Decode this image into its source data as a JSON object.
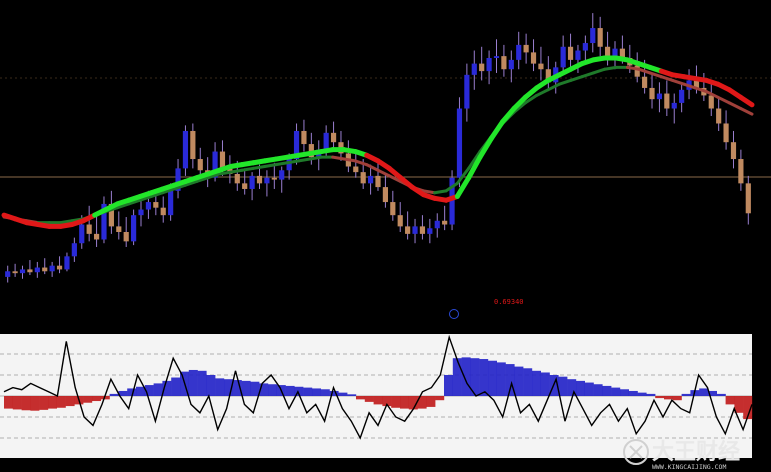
{
  "chart_data": [
    {
      "type": "candlestick",
      "panel": "price",
      "readout": "0.69340",
      "colors": {
        "up": "#2a2ad8",
        "down": "#c08a60",
        "wick": "#9a7fd0",
        "hline": "#8a6a4a"
      },
      "candles": [
        {
          "o": 4,
          "h": 16,
          "l": -2,
          "c": 10
        },
        {
          "o": 10,
          "h": 18,
          "l": 4,
          "c": 8
        },
        {
          "o": 8,
          "h": 16,
          "l": 2,
          "c": 12
        },
        {
          "o": 12,
          "h": 22,
          "l": 6,
          "c": 9
        },
        {
          "o": 9,
          "h": 20,
          "l": 3,
          "c": 14
        },
        {
          "o": 14,
          "h": 24,
          "l": 7,
          "c": 10
        },
        {
          "o": 10,
          "h": 20,
          "l": 4,
          "c": 16
        },
        {
          "o": 16,
          "h": 26,
          "l": 8,
          "c": 12
        },
        {
          "o": 12,
          "h": 30,
          "l": 10,
          "c": 26
        },
        {
          "o": 26,
          "h": 46,
          "l": 20,
          "c": 40
        },
        {
          "o": 40,
          "h": 70,
          "l": 34,
          "c": 60
        },
        {
          "o": 60,
          "h": 80,
          "l": 42,
          "c": 50
        },
        {
          "o": 50,
          "h": 72,
          "l": 36,
          "c": 44
        },
        {
          "o": 44,
          "h": 90,
          "l": 40,
          "c": 82
        },
        {
          "o": 82,
          "h": 96,
          "l": 50,
          "c": 58
        },
        {
          "o": 58,
          "h": 74,
          "l": 44,
          "c": 52
        },
        {
          "o": 52,
          "h": 68,
          "l": 36,
          "c": 42
        },
        {
          "o": 42,
          "h": 76,
          "l": 38,
          "c": 70
        },
        {
          "o": 70,
          "h": 88,
          "l": 58,
          "c": 76
        },
        {
          "o": 76,
          "h": 96,
          "l": 66,
          "c": 84
        },
        {
          "o": 84,
          "h": 98,
          "l": 70,
          "c": 78
        },
        {
          "o": 78,
          "h": 90,
          "l": 62,
          "c": 70
        },
        {
          "o": 70,
          "h": 104,
          "l": 64,
          "c": 96
        },
        {
          "o": 96,
          "h": 130,
          "l": 88,
          "c": 120
        },
        {
          "o": 120,
          "h": 166,
          "l": 112,
          "c": 160
        },
        {
          "o": 160,
          "h": 168,
          "l": 120,
          "c": 130
        },
        {
          "o": 130,
          "h": 142,
          "l": 106,
          "c": 118
        },
        {
          "o": 118,
          "h": 132,
          "l": 100,
          "c": 110
        },
        {
          "o": 110,
          "h": 148,
          "l": 106,
          "c": 138
        },
        {
          "o": 138,
          "h": 150,
          "l": 112,
          "c": 120
        },
        {
          "o": 120,
          "h": 134,
          "l": 104,
          "c": 114
        },
        {
          "o": 114,
          "h": 128,
          "l": 96,
          "c": 104
        },
        {
          "o": 104,
          "h": 120,
          "l": 92,
          "c": 98
        },
        {
          "o": 98,
          "h": 116,
          "l": 86,
          "c": 112
        },
        {
          "o": 112,
          "h": 124,
          "l": 98,
          "c": 104
        },
        {
          "o": 104,
          "h": 118,
          "l": 90,
          "c": 110
        },
        {
          "o": 110,
          "h": 126,
          "l": 98,
          "c": 108
        },
        {
          "o": 108,
          "h": 122,
          "l": 94,
          "c": 118
        },
        {
          "o": 118,
          "h": 136,
          "l": 108,
          "c": 130
        },
        {
          "o": 130,
          "h": 168,
          "l": 124,
          "c": 160
        },
        {
          "o": 160,
          "h": 172,
          "l": 138,
          "c": 146
        },
        {
          "o": 146,
          "h": 158,
          "l": 124,
          "c": 132
        },
        {
          "o": 132,
          "h": 150,
          "l": 118,
          "c": 140
        },
        {
          "o": 140,
          "h": 166,
          "l": 132,
          "c": 158
        },
        {
          "o": 158,
          "h": 170,
          "l": 140,
          "c": 148
        },
        {
          "o": 148,
          "h": 160,
          "l": 128,
          "c": 136
        },
        {
          "o": 136,
          "h": 150,
          "l": 116,
          "c": 122
        },
        {
          "o": 122,
          "h": 138,
          "l": 110,
          "c": 116
        },
        {
          "o": 116,
          "h": 130,
          "l": 98,
          "c": 104
        },
        {
          "o": 104,
          "h": 124,
          "l": 92,
          "c": 112
        },
        {
          "o": 112,
          "h": 128,
          "l": 96,
          "c": 100
        },
        {
          "o": 100,
          "h": 114,
          "l": 78,
          "c": 84
        },
        {
          "o": 84,
          "h": 96,
          "l": 64,
          "c": 70
        },
        {
          "o": 70,
          "h": 84,
          "l": 52,
          "c": 58
        },
        {
          "o": 58,
          "h": 74,
          "l": 44,
          "c": 50
        },
        {
          "o": 50,
          "h": 66,
          "l": 40,
          "c": 58
        },
        {
          "o": 58,
          "h": 70,
          "l": 44,
          "c": 50
        },
        {
          "o": 50,
          "h": 66,
          "l": 40,
          "c": 56
        },
        {
          "o": 56,
          "h": 72,
          "l": 46,
          "c": 64
        },
        {
          "o": 64,
          "h": 80,
          "l": 54,
          "c": 60
        },
        {
          "o": 60,
          "h": 118,
          "l": 54,
          "c": 110
        },
        {
          "o": 110,
          "h": 196,
          "l": 100,
          "c": 184
        },
        {
          "o": 184,
          "h": 232,
          "l": 170,
          "c": 220
        },
        {
          "o": 220,
          "h": 246,
          "l": 204,
          "c": 232
        },
        {
          "o": 232,
          "h": 250,
          "l": 214,
          "c": 224
        },
        {
          "o": 224,
          "h": 246,
          "l": 210,
          "c": 238
        },
        {
          "o": 238,
          "h": 258,
          "l": 222,
          "c": 240
        },
        {
          "o": 240,
          "h": 252,
          "l": 218,
          "c": 226
        },
        {
          "o": 226,
          "h": 246,
          "l": 212,
          "c": 236
        },
        {
          "o": 236,
          "h": 266,
          "l": 226,
          "c": 252
        },
        {
          "o": 252,
          "h": 264,
          "l": 232,
          "c": 244
        },
        {
          "o": 244,
          "h": 258,
          "l": 224,
          "c": 232
        },
        {
          "o": 232,
          "h": 250,
          "l": 214,
          "c": 226
        },
        {
          "o": 226,
          "h": 240,
          "l": 204,
          "c": 212
        },
        {
          "o": 212,
          "h": 234,
          "l": 200,
          "c": 228
        },
        {
          "o": 228,
          "h": 262,
          "l": 220,
          "c": 250
        },
        {
          "o": 250,
          "h": 264,
          "l": 226,
          "c": 236
        },
        {
          "o": 236,
          "h": 252,
          "l": 222,
          "c": 246
        },
        {
          "o": 246,
          "h": 262,
          "l": 232,
          "c": 254
        },
        {
          "o": 254,
          "h": 286,
          "l": 244,
          "c": 270
        },
        {
          "o": 270,
          "h": 282,
          "l": 240,
          "c": 250
        },
        {
          "o": 250,
          "h": 266,
          "l": 230,
          "c": 240
        },
        {
          "o": 240,
          "h": 256,
          "l": 226,
          "c": 248
        },
        {
          "o": 248,
          "h": 262,
          "l": 232,
          "c": 238
        },
        {
          "o": 238,
          "h": 252,
          "l": 222,
          "c": 230
        },
        {
          "o": 230,
          "h": 244,
          "l": 212,
          "c": 218
        },
        {
          "o": 218,
          "h": 236,
          "l": 200,
          "c": 206
        },
        {
          "o": 206,
          "h": 220,
          "l": 184,
          "c": 194
        },
        {
          "o": 194,
          "h": 212,
          "l": 180,
          "c": 200
        },
        {
          "o": 200,
          "h": 214,
          "l": 176,
          "c": 184
        },
        {
          "o": 184,
          "h": 200,
          "l": 168,
          "c": 190
        },
        {
          "o": 190,
          "h": 210,
          "l": 180,
          "c": 204
        },
        {
          "o": 204,
          "h": 226,
          "l": 194,
          "c": 214
        },
        {
          "o": 214,
          "h": 230,
          "l": 200,
          "c": 206
        },
        {
          "o": 206,
          "h": 222,
          "l": 192,
          "c": 198
        },
        {
          "o": 198,
          "h": 210,
          "l": 176,
          "c": 184
        },
        {
          "o": 184,
          "h": 196,
          "l": 160,
          "c": 168
        },
        {
          "o": 168,
          "h": 182,
          "l": 140,
          "c": 148
        },
        {
          "o": 148,
          "h": 160,
          "l": 120,
          "c": 130
        },
        {
          "o": 130,
          "h": 140,
          "l": 96,
          "c": 104
        },
        {
          "o": 104,
          "h": 112,
          "l": 60,
          "c": 72
        }
      ],
      "ma_fast": [
        70,
        66,
        62,
        60,
        58,
        58,
        60,
        64,
        70,
        76,
        82,
        86,
        90,
        94,
        98,
        102,
        106,
        110,
        114,
        118,
        122,
        124,
        126,
        128,
        130,
        132,
        134,
        136,
        138,
        140,
        140,
        138,
        134,
        128,
        120,
        110,
        100,
        92,
        88,
        86,
        90,
        110,
        132,
        152,
        170,
        184,
        196,
        206,
        214,
        220,
        226,
        232,
        236,
        238,
        238,
        236,
        232,
        228,
        224,
        220,
        218,
        216,
        214,
        210,
        204,
        196,
        188
      ],
      "ma_fast_color": [
        1,
        1,
        1,
        1,
        1,
        1,
        1,
        1,
        0,
        0,
        0,
        0,
        0,
        0,
        0,
        0,
        0,
        0,
        0,
        0,
        0,
        0,
        0,
        0,
        0,
        0,
        0,
        0,
        0,
        0,
        0,
        0,
        1,
        1,
        1,
        1,
        1,
        1,
        1,
        1,
        0,
        0,
        0,
        0,
        0,
        0,
        0,
        0,
        0,
        0,
        0,
        0,
        0,
        0,
        0,
        0,
        0,
        0,
        1,
        1,
        1,
        1,
        1,
        1,
        1,
        1,
        1
      ],
      "ma_slow": [
        68,
        66,
        64,
        62,
        62,
        62,
        64,
        66,
        70,
        74,
        78,
        82,
        86,
        90,
        94,
        98,
        102,
        106,
        110,
        114,
        116,
        118,
        120,
        122,
        124,
        126,
        128,
        130,
        132,
        132,
        130,
        128,
        124,
        118,
        112,
        106,
        100,
        96,
        94,
        96,
        104,
        120,
        138,
        154,
        168,
        180,
        190,
        198,
        204,
        210,
        214,
        218,
        222,
        226,
        228,
        228,
        226,
        222,
        218,
        214,
        210,
        206,
        202,
        196,
        190,
        184,
        178
      ],
      "ma_slow_colors": {
        "up": "#1f7a2a",
        "down": "#a0403a"
      },
      "ma_fast_colors": {
        "up": "#22e62a",
        "down": "#e01818"
      }
    },
    {
      "type": "histogram",
      "panel": "oscillator",
      "colors": {
        "positive": "#2020c8",
        "negative": "#c01818",
        "line": "#000000",
        "background": "#f4f4f4"
      },
      "levels": [
        -1,
        -0.5,
        0,
        0.5,
        1
      ],
      "histogram": [
        -0.3,
        -0.32,
        -0.34,
        -0.35,
        -0.33,
        -0.3,
        -0.28,
        -0.24,
        -0.2,
        -0.16,
        -0.12,
        -0.08,
        0.05,
        0.12,
        0.18,
        0.22,
        0.26,
        0.3,
        0.36,
        0.44,
        0.58,
        0.62,
        0.6,
        0.5,
        0.42,
        0.4,
        0.38,
        0.36,
        0.34,
        0.3,
        0.28,
        0.26,
        0.24,
        0.22,
        0.2,
        0.18,
        0.16,
        0.12,
        0.08,
        0.04,
        -0.08,
        -0.14,
        -0.2,
        -0.24,
        -0.28,
        -0.3,
        -0.32,
        -0.3,
        -0.26,
        -0.1,
        0.5,
        0.9,
        0.92,
        0.9,
        0.88,
        0.84,
        0.8,
        0.76,
        0.7,
        0.66,
        0.6,
        0.56,
        0.5,
        0.46,
        0.4,
        0.36,
        0.32,
        0.28,
        0.24,
        0.2,
        0.16,
        0.12,
        0.08,
        0.05,
        -0.05,
        -0.08,
        -0.1,
        0.05,
        0.14,
        0.18,
        0.12,
        0.05,
        -0.2,
        -0.4,
        -0.55
      ],
      "line": [
        0.1,
        0.2,
        0.15,
        0.3,
        0.2,
        0.1,
        0.0,
        1.3,
        0.2,
        -0.5,
        -0.7,
        -0.2,
        0.4,
        0.0,
        -0.3,
        0.5,
        0.1,
        -0.6,
        0.2,
        0.9,
        0.5,
        -0.2,
        -0.4,
        0.0,
        -0.8,
        -0.3,
        0.6,
        -0.2,
        -0.4,
        0.3,
        0.5,
        0.2,
        -0.3,
        0.1,
        -0.4,
        -0.2,
        -0.6,
        0.2,
        -0.3,
        -0.6,
        -1.0,
        -0.4,
        -0.7,
        -0.2,
        -0.5,
        -0.6,
        -0.3,
        0.1,
        0.2,
        0.5,
        1.4,
        0.8,
        0.3,
        0.0,
        0.1,
        -0.1,
        -0.5,
        0.3,
        -0.4,
        -0.2,
        -0.6,
        -0.1,
        0.4,
        -0.6,
        0.1,
        -0.3,
        -0.7,
        -0.4,
        -0.2,
        -0.6,
        -0.3,
        -0.9,
        -0.6,
        -0.1,
        -0.5,
        -0.1,
        -0.3,
        -0.4,
        0.5,
        0.2,
        -0.5,
        -0.9,
        -0.3,
        -0.8,
        -0.2
      ]
    }
  ],
  "watermark": {
    "text": "大王财经",
    "url": "WWW.KINGCAIJING.COM"
  }
}
